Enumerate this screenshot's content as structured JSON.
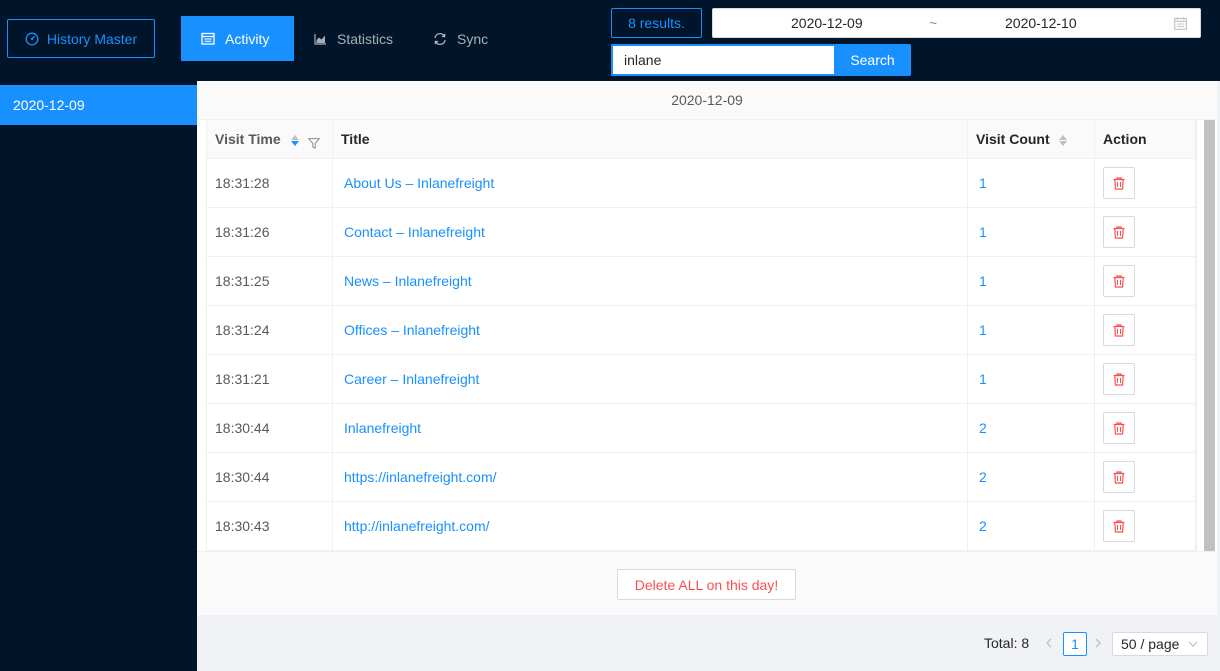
{
  "header": {
    "brand_label": "History Master",
    "nav": [
      {
        "label": "Activity",
        "icon": "calendar-icon",
        "active": true
      },
      {
        "label": "Statistics",
        "icon": "area-chart-icon",
        "active": false
      },
      {
        "label": "Sync",
        "icon": "sync-icon",
        "active": false
      }
    ],
    "results_label": "8 results.",
    "date_range": {
      "start": "2020-12-09",
      "separator": "~",
      "end": "2020-12-10"
    },
    "search": {
      "value": "inlane",
      "button_label": "Search"
    }
  },
  "sidebar": {
    "items": [
      {
        "label": "2020-12-09",
        "selected": true
      }
    ]
  },
  "main": {
    "day_title": "2020-12-09",
    "columns": {
      "visit_time": "Visit Time",
      "title": "Title",
      "visit_count": "Visit Count",
      "action": "Action"
    },
    "rows": [
      {
        "time": "18:31:28",
        "title": "About Us – Inlanefreight",
        "count": "1"
      },
      {
        "time": "18:31:26",
        "title": "Contact – Inlanefreight",
        "count": "1"
      },
      {
        "time": "18:31:25",
        "title": "News – Inlanefreight",
        "count": "1"
      },
      {
        "time": "18:31:24",
        "title": "Offices – Inlanefreight",
        "count": "1"
      },
      {
        "time": "18:31:21",
        "title": "Career – Inlanefreight",
        "count": "1"
      },
      {
        "time": "18:30:44",
        "title": "Inlanefreight",
        "count": "2"
      },
      {
        "time": "18:30:44",
        "title": "https://inlanefreight.com/",
        "count": "2"
      },
      {
        "time": "18:30:43",
        "title": "http://inlanefreight.com/",
        "count": "2"
      }
    ],
    "delete_all_label": "Delete ALL on this day!"
  },
  "pagination": {
    "total_label": "Total: 8",
    "current_page": "1",
    "page_size_label": "50 / page"
  },
  "colors": {
    "primary": "#1890ff",
    "header_bg": "#001529",
    "danger": "#ff4d4f"
  }
}
